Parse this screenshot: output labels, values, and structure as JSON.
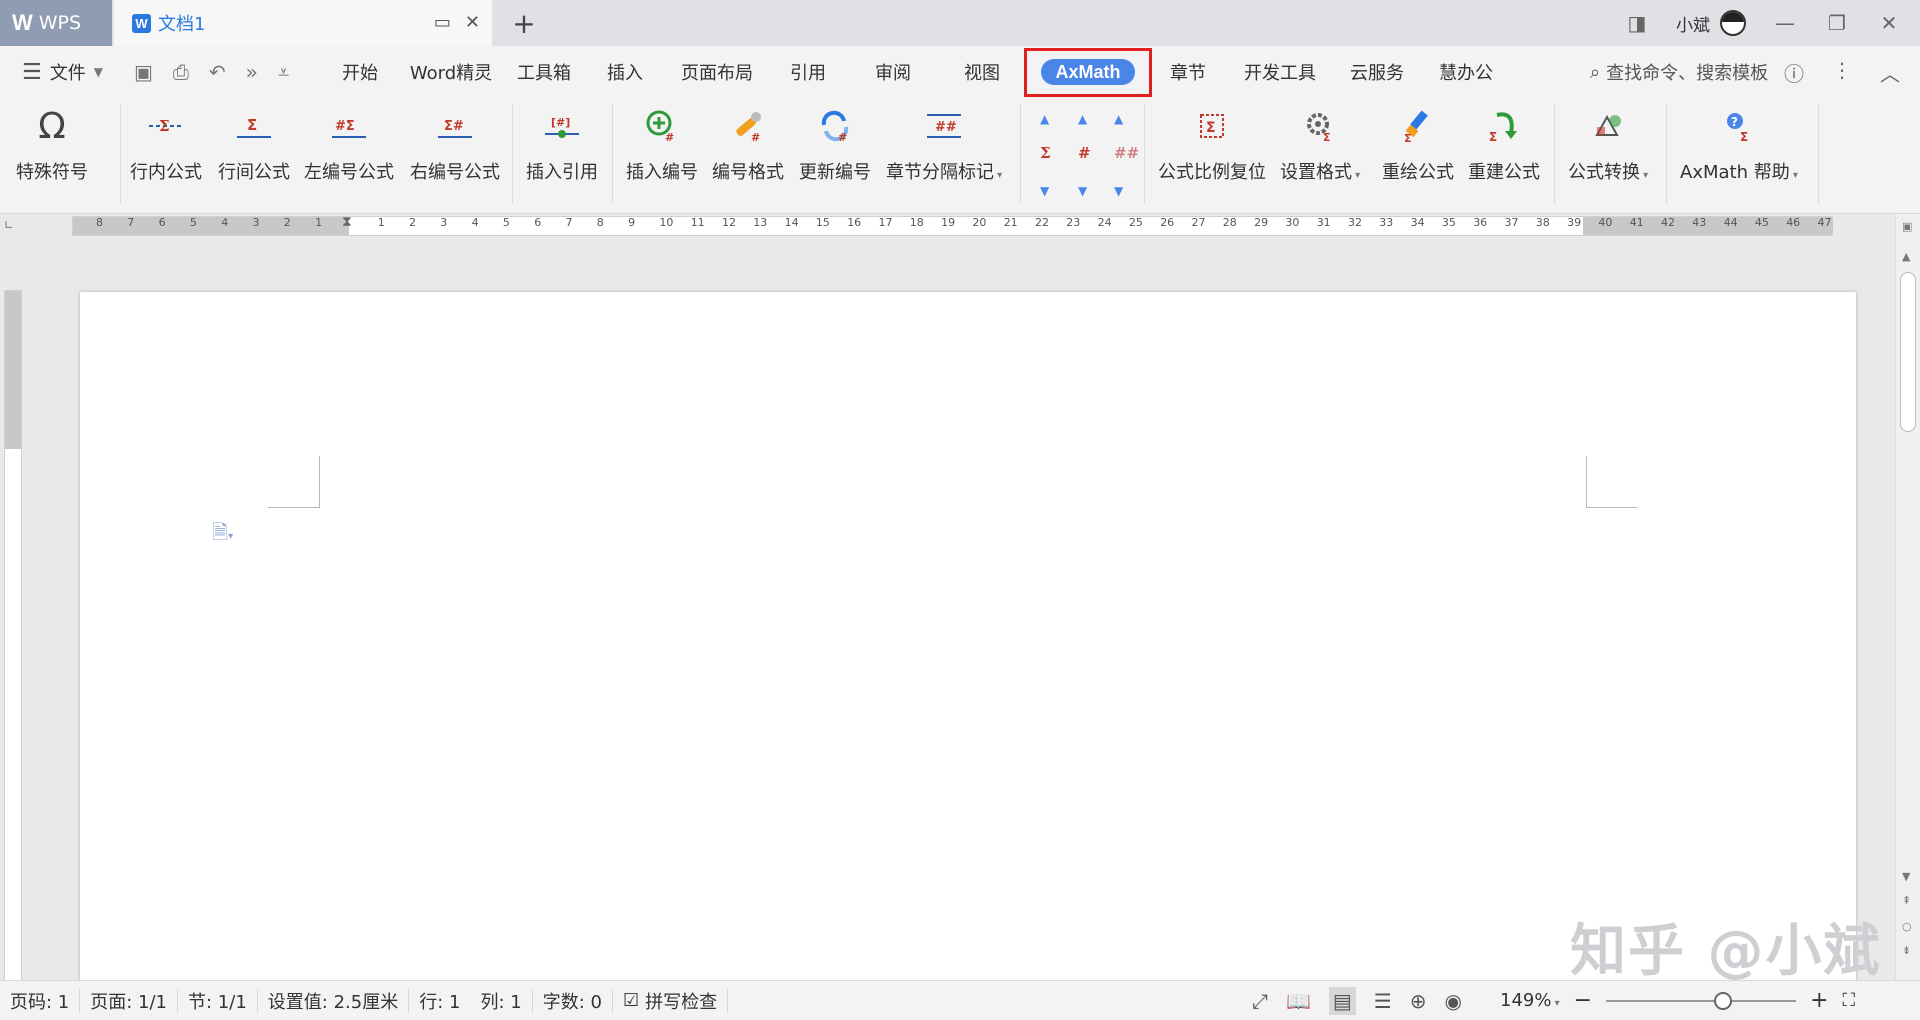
{
  "titlebar": {
    "app_name": "WPS",
    "doc_tab": "文档1",
    "user_name": "小斌"
  },
  "menubar": {
    "file": "文件",
    "tabs": [
      "开始",
      "Word精灵",
      "工具箱",
      "插入",
      "页面布局",
      "引用",
      "审阅",
      "视图",
      "AxMath",
      "章节",
      "开发工具",
      "云服务",
      "慧办公"
    ],
    "active_tab": "AxMath",
    "search_placeholder": "查找命令、搜索模板"
  },
  "ribbon": {
    "special_symbol": "特殊符号",
    "inline_formula": "行内公式",
    "display_formula": "行间公式",
    "left_numbered": "左编号公式",
    "right_numbered": "右编号公式",
    "insert_ref": "插入引用",
    "insert_number": "插入编号",
    "number_format": "编号格式",
    "update_number": "更新编号",
    "chapter_mark": "章节分隔标记",
    "scale_reset": "公式比例复位",
    "set_format": "设置格式",
    "redraw": "重绘公式",
    "rebuild": "重建公式",
    "convert": "公式转换",
    "help": "AxMath 帮助"
  },
  "ruler": {
    "ticks": [
      "8",
      "7",
      "6",
      "5",
      "4",
      "3",
      "2",
      "1",
      "",
      "1",
      "2",
      "3",
      "4",
      "5",
      "6",
      "7",
      "8",
      "9",
      "10",
      "11",
      "12",
      "13",
      "14",
      "15",
      "16",
      "17",
      "18",
      "19",
      "20",
      "21",
      "22",
      "23",
      "24",
      "25",
      "26",
      "27",
      "28",
      "29",
      "30",
      "31",
      "32",
      "33",
      "34",
      "35",
      "36",
      "37",
      "38",
      "39",
      "40",
      "41",
      "42",
      "43",
      "44",
      "45",
      "46",
      "47"
    ]
  },
  "watermark": "知乎 @小斌",
  "statusbar": {
    "page_num": "页码: 1",
    "pages": "页面: 1/1",
    "section": "节: 1/1",
    "setting": "设置值: 2.5厘米",
    "row": "行: 1",
    "col": "列: 1",
    "words": "字数: 0",
    "spell": "拼写检查",
    "zoom": "149%"
  }
}
